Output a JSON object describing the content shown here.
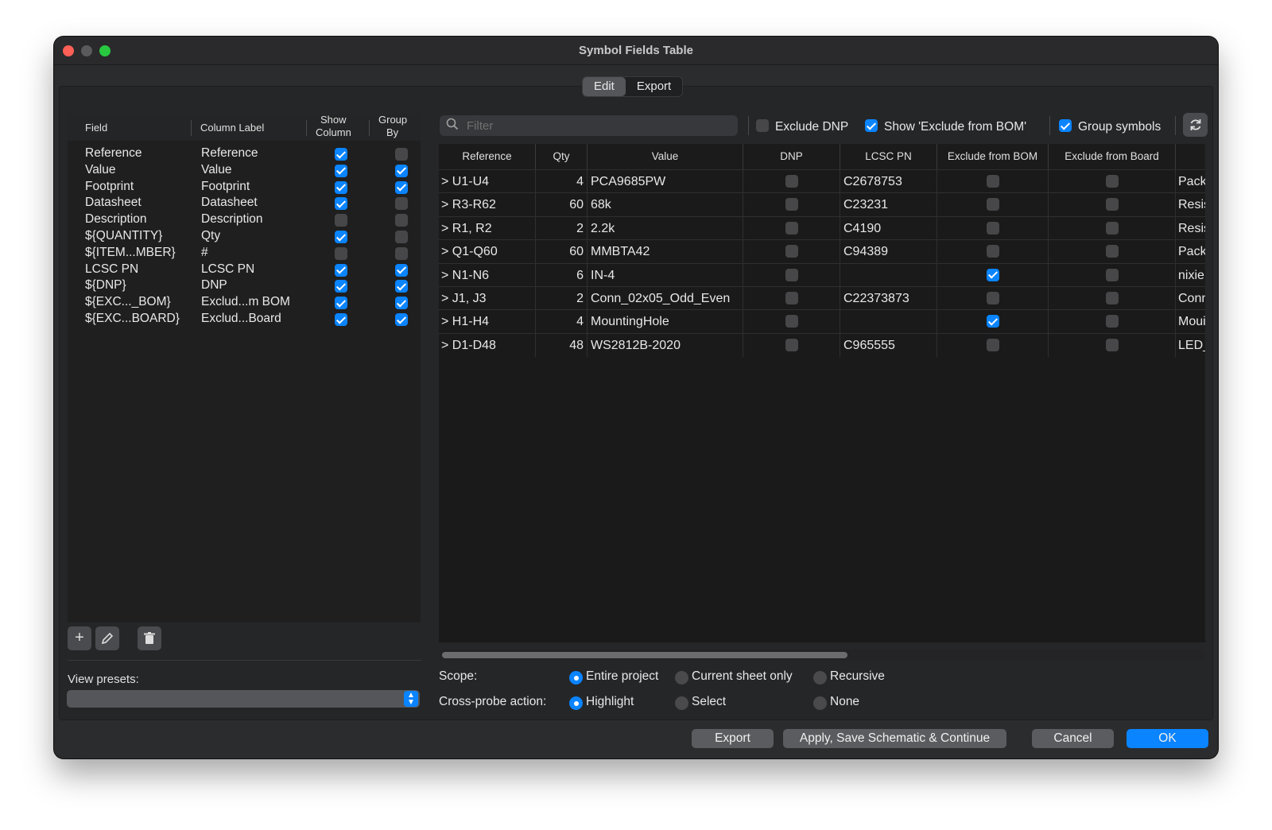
{
  "window": {
    "title": "Symbol Fields Table"
  },
  "tabs": [
    {
      "label": "Edit",
      "active": true
    },
    {
      "label": "Export",
      "active": false
    }
  ],
  "fields_panel": {
    "headers": {
      "field": "Field",
      "column_label": "Column Label",
      "show_column_1": "Show",
      "show_column_2": "Column",
      "group_by_1": "Group",
      "group_by_2": "By"
    },
    "rows": [
      {
        "field": "Reference",
        "label": "Reference",
        "show": true,
        "group": false
      },
      {
        "field": "Value",
        "label": "Value",
        "show": true,
        "group": true
      },
      {
        "field": "Footprint",
        "label": "Footprint",
        "show": true,
        "group": true
      },
      {
        "field": "Datasheet",
        "label": "Datasheet",
        "show": true,
        "group": false
      },
      {
        "field": "Description",
        "label": "Description",
        "show": false,
        "group": false
      },
      {
        "field": "${QUANTITY}",
        "label": "Qty",
        "show": true,
        "group": false
      },
      {
        "field": "${ITEM...MBER}",
        "label": "#",
        "show": false,
        "group": false
      },
      {
        "field": "LCSC PN",
        "label": "LCSC PN",
        "show": true,
        "group": true
      },
      {
        "field": "${DNP}",
        "label": "DNP",
        "show": true,
        "group": true
      },
      {
        "field": "${EXC..._BOM}",
        "label": "Exclud...m BOM",
        "show": true,
        "group": true
      },
      {
        "field": "${EXC...BOARD}",
        "label": "Exclud...Board",
        "show": true,
        "group": true
      }
    ],
    "tool_icons": [
      "plus-icon",
      "pencil-icon",
      "trash-icon"
    ],
    "view_presets_label": "View presets:",
    "view_presets_value": ""
  },
  "toolbar": {
    "filter_placeholder": "Filter",
    "exclude_dnp": {
      "label": "Exclude DNP",
      "checked": false
    },
    "show_exclude_bom": {
      "label": "Show 'Exclude from BOM'",
      "checked": true
    },
    "group_symbols": {
      "label": "Group symbols",
      "checked": true
    },
    "refresh_icon": "refresh-icon"
  },
  "grid": {
    "columns": [
      "Reference",
      "Qty",
      "Value",
      "DNP",
      "LCSC PN",
      "Exclude from BOM",
      "Exclude from Board",
      ""
    ],
    "rows": [
      {
        "ref": "U1-U4",
        "qty": "4",
        "value": "PCA9685PW",
        "dnp": false,
        "lcsc": "C2678753",
        "ex_bom": false,
        "ex_board": false,
        "extra": "Pack"
      },
      {
        "ref": "R3-R62",
        "qty": "60",
        "value": "68k",
        "dnp": false,
        "lcsc": "C23231",
        "ex_bom": false,
        "ex_board": false,
        "extra": "Resis"
      },
      {
        "ref": "R1, R2",
        "qty": "2",
        "value": "2.2k",
        "dnp": false,
        "lcsc": "C4190",
        "ex_bom": false,
        "ex_board": false,
        "extra": "Resis"
      },
      {
        "ref": "Q1-Q60",
        "qty": "60",
        "value": "MMBTA42",
        "dnp": false,
        "lcsc": "C94389",
        "ex_bom": false,
        "ex_board": false,
        "extra": "Pack"
      },
      {
        "ref": "N1-N6",
        "qty": "6",
        "value": "IN-4",
        "dnp": false,
        "lcsc": "",
        "ex_bom": true,
        "ex_board": false,
        "extra": "nixie"
      },
      {
        "ref": "J1, J3",
        "qty": "2",
        "value": "Conn_02x05_Odd_Even",
        "dnp": false,
        "lcsc": "C22373873",
        "ex_bom": false,
        "ex_board": false,
        "extra": "Conn"
      },
      {
        "ref": "H1-H4",
        "qty": "4",
        "value": "MountingHole",
        "dnp": false,
        "lcsc": "",
        "ex_bom": true,
        "ex_board": false,
        "extra": "Moui"
      },
      {
        "ref": "D1-D48",
        "qty": "48",
        "value": "WS2812B-2020",
        "dnp": false,
        "lcsc": "C965555",
        "ex_bom": false,
        "ex_board": false,
        "extra": "LED_"
      }
    ],
    "expander": ">"
  },
  "scope": {
    "label": "Scope:",
    "options": [
      {
        "label": "Entire project",
        "selected": true
      },
      {
        "label": "Current sheet only",
        "selected": false
      },
      {
        "label": "Recursive",
        "selected": false
      }
    ]
  },
  "cross_probe": {
    "label": "Cross-probe action:",
    "options": [
      {
        "label": "Highlight",
        "selected": true
      },
      {
        "label": "Select",
        "selected": false
      },
      {
        "label": "None",
        "selected": false
      }
    ]
  },
  "buttons": {
    "export": "Export",
    "apply": "Apply, Save Schematic & Continue",
    "cancel": "Cancel",
    "ok": "OK"
  },
  "colors": {
    "accent": "#0a84ff",
    "window_bg": "#2b2c2e",
    "grid_bg": "#1a1a1a"
  }
}
